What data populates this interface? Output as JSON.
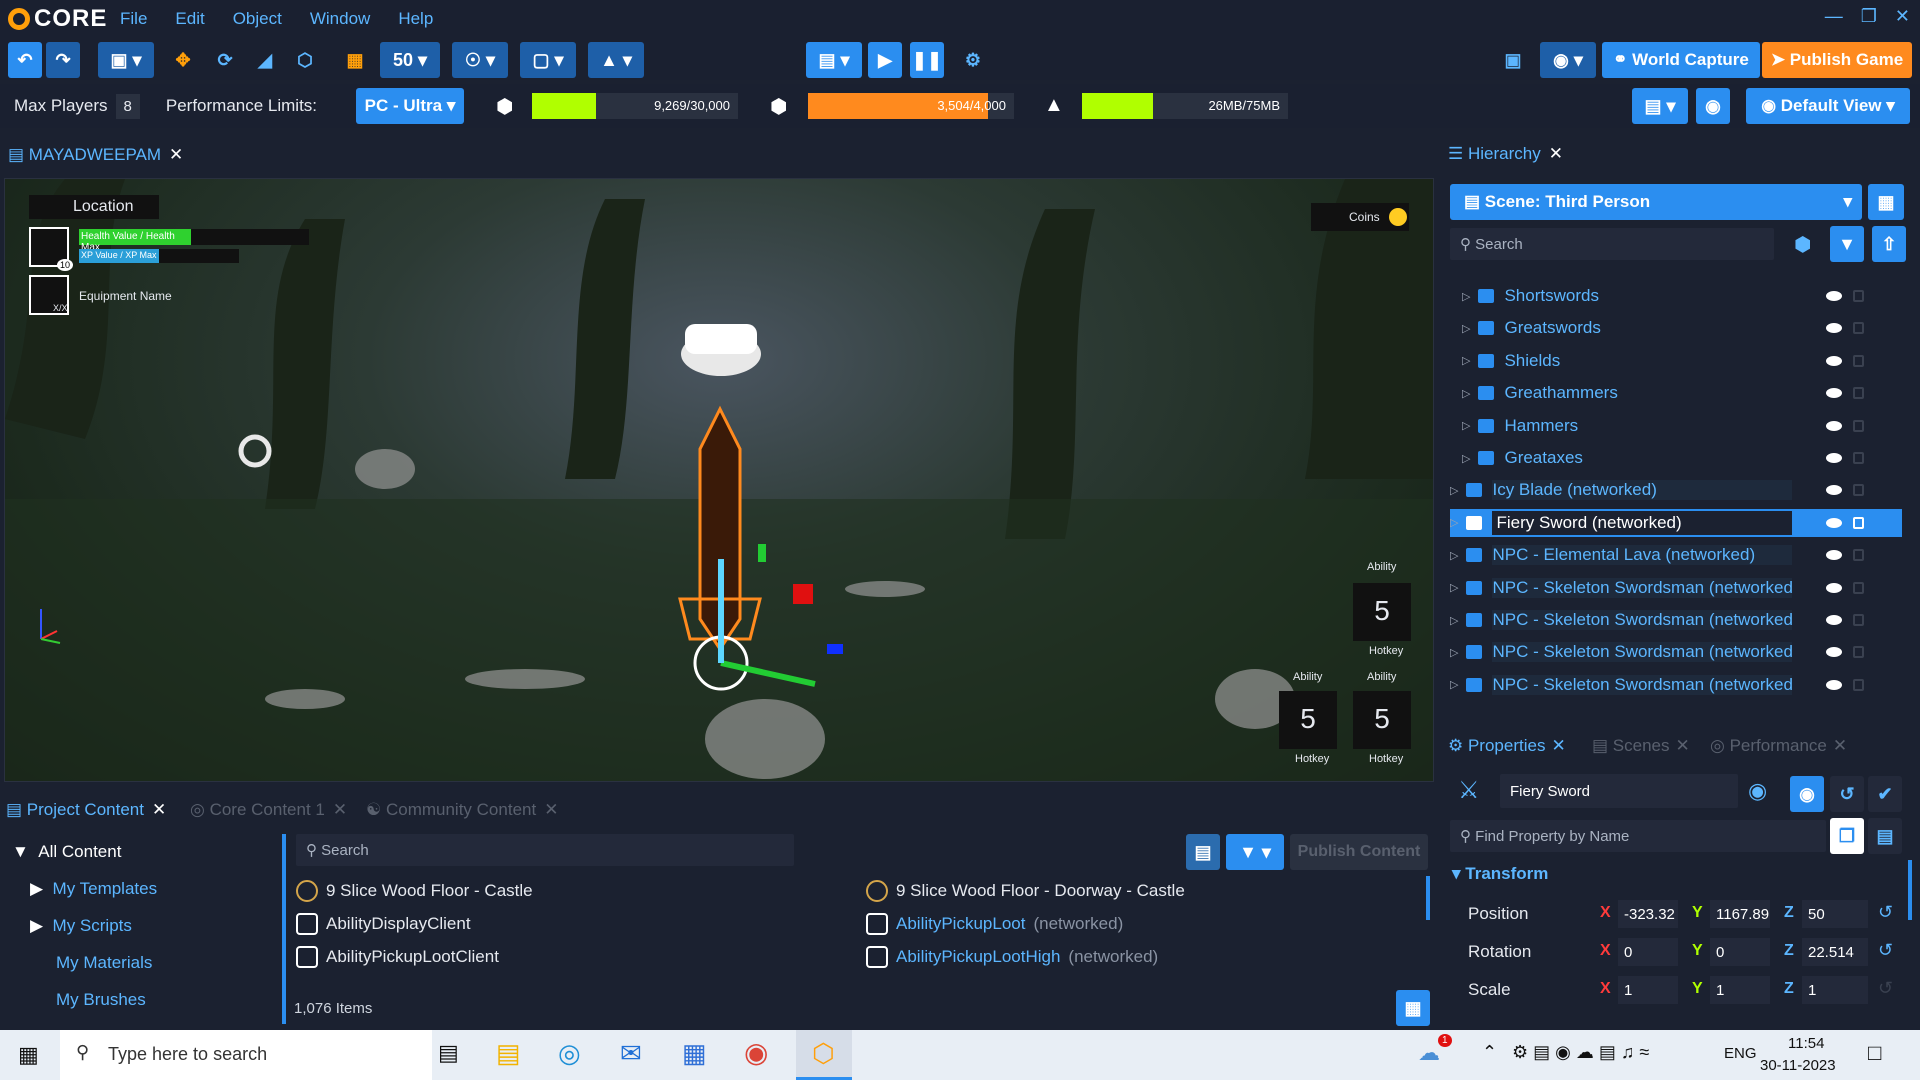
{
  "app": {
    "name": "CORE"
  },
  "menu": [
    "File",
    "Edit",
    "Object",
    "Window",
    "Help"
  ],
  "toolbar": {
    "grid_size": "50",
    "world_capture": "World Capture",
    "publish_game": "Publish Game",
    "default_view": "Default View"
  },
  "stats": {
    "max_players_label": "Max Players",
    "max_players": "8",
    "perf_label": "Performance Limits:",
    "perf_value": "PC - Ultra",
    "objects": {
      "text": "9,269/30,000",
      "fraction": 0.309
    },
    "networked": {
      "text": "3,504/4,000",
      "fraction": 0.876
    },
    "memory": {
      "text": "26MB/75MB",
      "fraction": 0.347
    }
  },
  "viewport": {
    "tab": "MAYADWEEPAM",
    "hud": {
      "location": "Location",
      "health": "Health Value / Health Max",
      "xp": "XP Value / XP Max",
      "level": "10",
      "equipment": "Equipment Name",
      "equipment_count": "X/X",
      "coins": "Coins",
      "ability": "Ability",
      "hotkey": "Hotkey",
      "ability_count": "5"
    }
  },
  "hierarchy": {
    "tab": "Hierarchy",
    "scene": "Scene: Third Person",
    "search_placeholder": "Search",
    "items": [
      {
        "label": "Shortswords",
        "indent": 1,
        "selected": false
      },
      {
        "label": "Greatswords",
        "indent": 1,
        "selected": false
      },
      {
        "label": "Shields",
        "indent": 1,
        "selected": false
      },
      {
        "label": "Greathammers",
        "indent": 1,
        "selected": false
      },
      {
        "label": "Hammers",
        "indent": 1,
        "selected": false
      },
      {
        "label": "Greataxes",
        "indent": 1,
        "selected": false
      },
      {
        "label": "Icy Blade (networked)",
        "indent": 0,
        "selected": false
      },
      {
        "label": "Fiery Sword (networked)",
        "indent": 0,
        "selected": true
      },
      {
        "label": "NPC - Elemental Lava (networked)",
        "indent": 0,
        "selected": false
      },
      {
        "label": "NPC - Skeleton Swordsman (networked",
        "indent": 0,
        "selected": false
      },
      {
        "label": "NPC - Skeleton Swordsman (networked",
        "indent": 0,
        "selected": false
      },
      {
        "label": "NPC - Skeleton Swordsman (networked",
        "indent": 0,
        "selected": false
      },
      {
        "label": "NPC - Skeleton Swordsman (networked",
        "indent": 0,
        "selected": false
      }
    ]
  },
  "properties": {
    "tabs": [
      "Properties",
      "Scenes",
      "Performance"
    ],
    "object_name": "Fiery Sword",
    "find_placeholder": "Find Property by Name",
    "section": "Transform",
    "position": {
      "label": "Position",
      "x": "-323.32",
      "y": "1167.89",
      "z": "50"
    },
    "rotation": {
      "label": "Rotation",
      "x": "0",
      "y": "0",
      "z": "22.514"
    },
    "scale": {
      "label": "Scale",
      "x": "1",
      "y": "1",
      "z": "1"
    }
  },
  "content": {
    "tabs": [
      "Project Content",
      "Core Content 1",
      "Community Content"
    ],
    "tree": [
      "All Content",
      "My Templates",
      "My Scripts",
      "My Materials",
      "My Brushes"
    ],
    "search_placeholder": "Search",
    "publish": "Publish Content",
    "items_left": [
      {
        "label": "9 Slice Wood Floor - Castle",
        "suffix": ""
      },
      {
        "label": "AbilityDisplayClient",
        "suffix": ""
      },
      {
        "label": "AbilityPickupLootClient",
        "suffix": ""
      }
    ],
    "items_right": [
      {
        "label": "9 Slice Wood Floor - Doorway - Castle",
        "suffix": ""
      },
      {
        "label": "AbilityPickupLoot",
        "suffix": "(networked)"
      },
      {
        "label": "AbilityPickupLootHigh",
        "suffix": "(networked)"
      }
    ],
    "count": "1,076 Items"
  },
  "taskbar": {
    "search": "Type here to search",
    "lang": "ENG",
    "time": "11:54",
    "date": "30-11-2023",
    "notif": "1"
  },
  "colors": {
    "accent": "#2b8ef0",
    "orange": "#ff8a1e",
    "lime": "#b0ff00",
    "bg": "#1b2130"
  }
}
